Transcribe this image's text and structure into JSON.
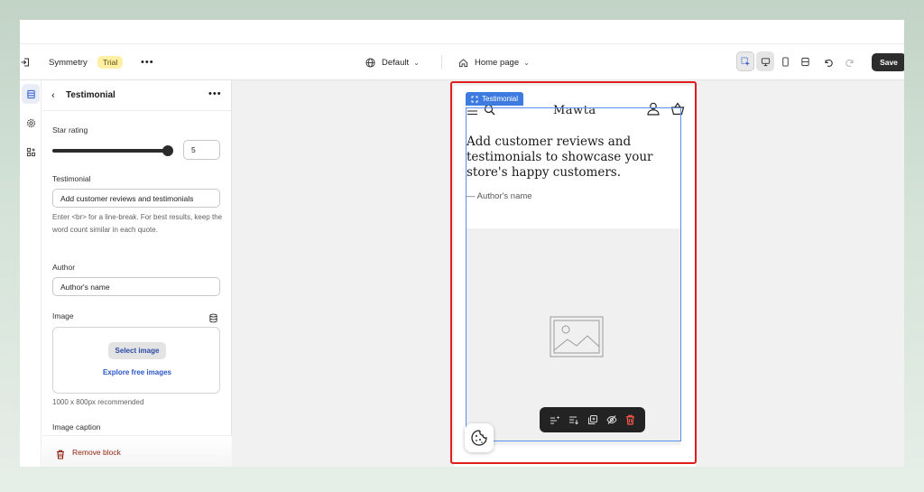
{
  "toolbar": {
    "store_name": "Symmetry",
    "trial_badge": "Trial",
    "more": "•••",
    "theme_selector": "Default",
    "page_selector": "Home page",
    "save_label": "Save"
  },
  "panel": {
    "title": "Testimonial",
    "more": "•••",
    "star_rating_label": "Star rating",
    "star_rating_value": "5",
    "star_rating_fraction": 1.0,
    "testimonial_label": "Testimonial",
    "testimonial_value": "Add customer reviews and testimonials",
    "testimonial_help": "Enter <br> for a line-break. For best results, keep the word count similar in each quote.",
    "author_label": "Author",
    "author_value": "Author's name",
    "image_label": "Image",
    "select_image": "Select image",
    "explore_images": "Explore free images",
    "image_help": "1000 x 800px recommended",
    "caption_label": "Image caption",
    "remove_block": "Remove block"
  },
  "preview": {
    "brand": "Mawta",
    "selection_tag": "Testimonial",
    "quote": "Add customer reviews and testimonials to showcase your store's happy customers.",
    "author": "— Author's name"
  },
  "colors": {
    "accent_blue": "#3e7be0",
    "highlight_red": "#e01e1e",
    "trial_yellow": "#fff0a6",
    "danger": "#8e1f0b"
  }
}
